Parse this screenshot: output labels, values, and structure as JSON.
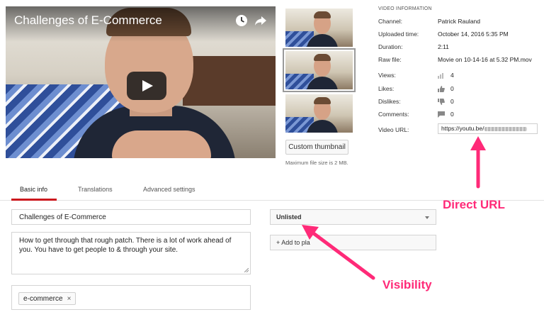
{
  "video": {
    "title": "Challenges of E-Commerce",
    "icons": {
      "watch_later": "clock-icon",
      "share": "share-arrow-icon",
      "play": "play-button-icon"
    }
  },
  "thumbnails": {
    "count_shown": 3,
    "selected_index": 1,
    "custom_button": "Custom thumbnail",
    "max_size_note": "Maximum file size is 2 MB."
  },
  "info": {
    "heading": "VIDEO INFORMATION",
    "channel_label": "Channel:",
    "channel": "Patrick Rauland",
    "uploaded_label": "Uploaded time:",
    "uploaded": "October 14, 2016 5:35 PM",
    "duration_label": "Duration:",
    "duration": "2:11",
    "raw_label": "Raw file:",
    "raw": "Movie on 10-14-16 at 5.32 PM.mov",
    "views_label": "Views:",
    "views": "4",
    "likes_label": "Likes:",
    "likes": "0",
    "dislikes_label": "Dislikes:",
    "dislikes": "0",
    "comments_label": "Comments:",
    "comments": "0",
    "url_label": "Video URL:",
    "url": "https://youtu.be/"
  },
  "tabs": [
    {
      "label": "Basic info",
      "active": true
    },
    {
      "label": "Translations",
      "active": false
    },
    {
      "label": "Advanced settings",
      "active": false
    }
  ],
  "form": {
    "title": "Challenges of E-Commerce",
    "description": "How to get through that rough patch. There is a lot of work ahead of you. You have to get people to & through your site.",
    "tag": "e-commerce",
    "tag_remove": "×",
    "visibility": "Unlisted",
    "add_to_playlist": "+ Add to pla"
  },
  "annotations": {
    "direct_url": "Direct URL",
    "visibility": "Visibility",
    "color": "#ff2a78"
  },
  "colors": {
    "accent": "#cc181e",
    "annotation": "#ff2a78"
  }
}
